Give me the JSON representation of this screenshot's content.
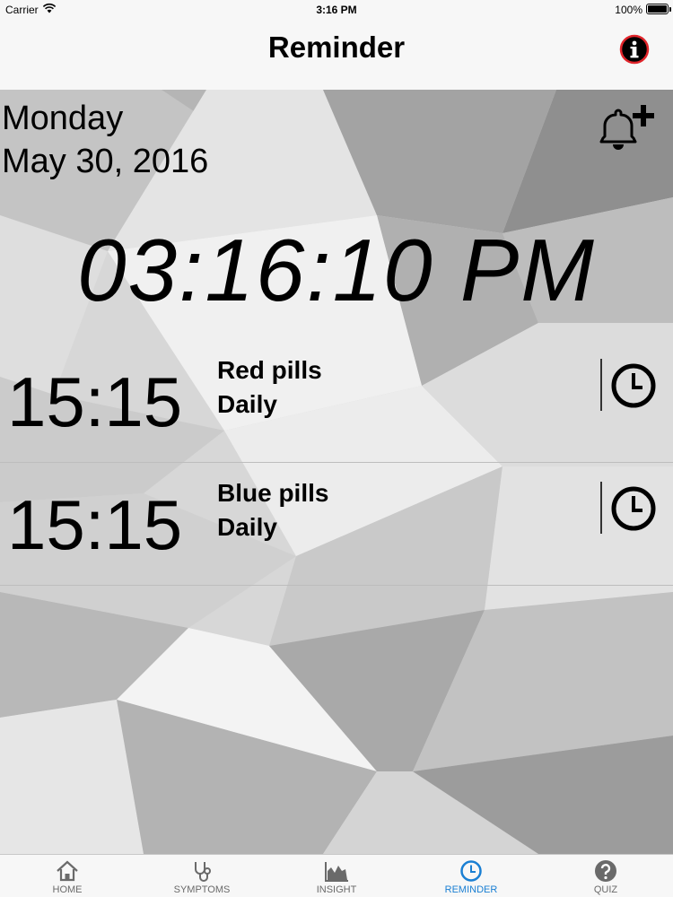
{
  "status_bar": {
    "carrier": "Carrier",
    "time": "3:16 PM",
    "battery": "100%"
  },
  "nav": {
    "title": "Reminder",
    "info_icon": "info-icon"
  },
  "header": {
    "day": "Monday",
    "date": "May 30, 2016",
    "add_icon": "bell-plus-icon"
  },
  "clock": {
    "time": "03:16:10 PM"
  },
  "reminders": [
    {
      "time": "15:15",
      "name": "Red pills",
      "frequency": "Daily",
      "icon": "clock-icon"
    },
    {
      "time": "15:15",
      "name": "Blue pills",
      "frequency": "Daily",
      "icon": "clock-icon"
    }
  ],
  "tabs": [
    {
      "label": "HOME",
      "icon": "home-icon",
      "active": false
    },
    {
      "label": "SYMPTOMS",
      "icon": "stethoscope-icon",
      "active": false
    },
    {
      "label": "INSIGHT",
      "icon": "chart-icon",
      "active": false
    },
    {
      "label": "REMINDER",
      "icon": "clock-icon",
      "active": true
    },
    {
      "label": "QUIZ",
      "icon": "question-icon",
      "active": false
    }
  ],
  "colors": {
    "accent": "#1a7fd3",
    "info_red": "#e0252b"
  }
}
